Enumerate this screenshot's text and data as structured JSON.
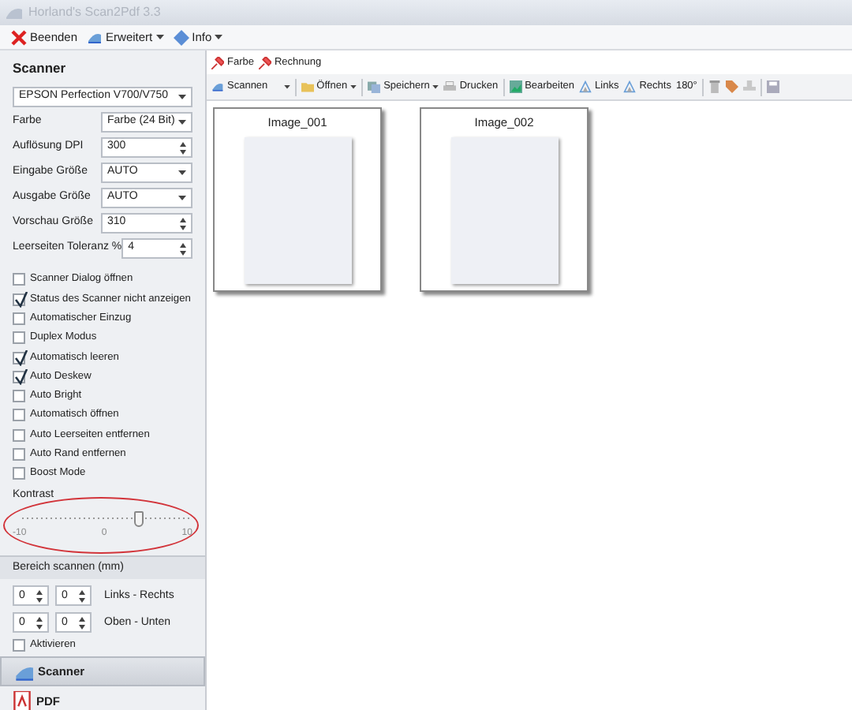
{
  "window": {
    "title": "Horland's Scan2Pdf 3.3"
  },
  "menu": [
    {
      "label": "Beenden",
      "kind": "close",
      "dropdown": false
    },
    {
      "label": "Erweitert",
      "kind": "scan",
      "dropdown": true
    },
    {
      "label": "Info",
      "kind": "info",
      "dropdown": true
    }
  ],
  "sidebar": {
    "title": "Scanner",
    "device": "EPSON Perfection V700/V750",
    "fields": [
      {
        "label": "Farbe",
        "value": "Farbe (24 Bit)",
        "kind": "select"
      },
      {
        "label": "Auflösung DPI",
        "value": "300",
        "kind": "spin"
      },
      {
        "label": "Eingabe Größe",
        "value": "AUTO",
        "kind": "select"
      },
      {
        "label": "Ausgabe Größe",
        "value": "AUTO",
        "kind": "select"
      },
      {
        "label": "Vorschau Größe",
        "value": "310",
        "kind": "spin"
      },
      {
        "label": "Leerseiten Toleranz %",
        "value": "4",
        "kind": "spin"
      }
    ],
    "options": [
      {
        "label": "Scanner Dialog öffnen",
        "checked": false
      },
      {
        "label": "Status des Scanner nicht anzeigen",
        "checked": true
      },
      {
        "label": "Automatischer Einzug",
        "checked": false
      },
      {
        "label": "Duplex Modus",
        "checked": false
      },
      {
        "label": "Automatisch leeren",
        "checked": true
      },
      {
        "label": "Auto Deskew",
        "checked": true
      },
      {
        "label": "Auto Bright",
        "checked": false
      },
      {
        "label": "Automatisch öffnen",
        "checked": false
      },
      {
        "label": "Auto Leerseiten entfernen",
        "checked": false
      },
      {
        "label": "Auto Rand entfernen",
        "checked": false
      },
      {
        "label": "Boost Mode",
        "checked": false
      }
    ],
    "contrast": {
      "label": "Kontrast",
      "level": 0.7,
      "scale": [
        "-10",
        "0",
        "10"
      ]
    },
    "area": {
      "title": "Bereich scannen (mm)",
      "rows": [
        {
          "values": [
            "0",
            "0"
          ],
          "label": "Links - Rechts"
        },
        {
          "values": [
            "0",
            "0"
          ],
          "label": "Oben - Unten"
        }
      ],
      "activate": {
        "label": "Aktivieren",
        "checked": false
      }
    },
    "nav": [
      {
        "label": "Scanner",
        "kind": "scanner",
        "selected": true
      },
      {
        "label": "PDF",
        "kind": "pdf",
        "selected": false
      }
    ]
  },
  "profiles": [
    {
      "label": "Farbe"
    },
    {
      "label": "Rechnung"
    }
  ],
  "toolbar": [
    {
      "label": "Scannen",
      "kind": "scan",
      "dropdown": true
    },
    {
      "kind": "sep"
    },
    {
      "label": "Öffnen",
      "kind": "folder",
      "dropdown": true
    },
    {
      "kind": "sep"
    },
    {
      "label": "Speichern",
      "kind": "disk",
      "dropdown": true
    },
    {
      "label": "Drucken",
      "kind": "print",
      "dropdown": false
    },
    {
      "kind": "sep"
    },
    {
      "label": "Bearbeiten",
      "kind": "edit",
      "dropdown": false
    },
    {
      "label": "Links",
      "kind": "rotate",
      "dropdown": false
    },
    {
      "label": "Rechts",
      "kind": "rotate",
      "dropdown": false
    },
    {
      "label": "180°",
      "kind": "text",
      "dropdown": false
    },
    {
      "kind": "sep"
    },
    {
      "kind": "trash"
    },
    {
      "kind": "tag"
    },
    {
      "kind": "stamp"
    },
    {
      "kind": "sep"
    },
    {
      "kind": "save"
    }
  ],
  "pages": [
    {
      "title": "Image_001"
    },
    {
      "title": "Image_002"
    }
  ]
}
